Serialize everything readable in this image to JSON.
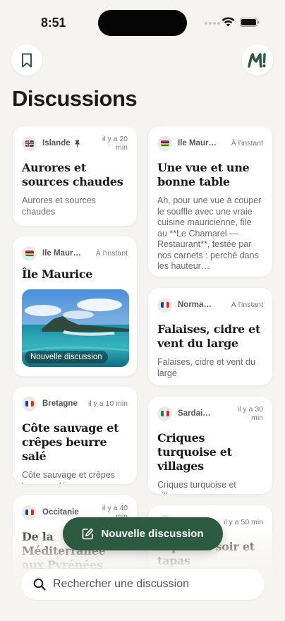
{
  "status_bar": {
    "time": "8:51"
  },
  "header": {
    "title": "Discussions"
  },
  "cards": [
    {
      "region": "Islande",
      "time": "il y a 20 min",
      "title": "Aurores et sources chaudes",
      "body": "Aurores et sources chaudes"
    },
    {
      "region": "Île Maurice",
      "time": "À l'instant",
      "title": "Une vue et une bonne table",
      "body": "Ah, pour une vue à couper le souffle avec une vraie cuisine mauricienne, file au **Le Chamarel — Restaurant**, testée par nos carnets : perché dans les hauteur…"
    },
    {
      "region": "Île Maurice",
      "time": "À l'instant",
      "title": "Île Maurice",
      "photo_label": "Nouvelle discussion"
    },
    {
      "region": "Normandie",
      "time": "À l'instant",
      "title": "Falaises, cidre et vent du large",
      "body": "Falaises, cidre et vent du large"
    },
    {
      "region": "Bretagne",
      "time": "il y a 10 min",
      "title": "Côte sauvage et crêpes beurre salé",
      "body": "Côte sauvage et crêpes beurre salé"
    },
    {
      "region": "Sardaigne",
      "time": "il y a 30 min",
      "title": "Criques turquoise et villages",
      "body": "Criques turquoise et villages"
    },
    {
      "region": "Occitanie",
      "time": "il y a 40 min",
      "title": "De la Méditerranée aux Pyrénées"
    },
    {
      "time": "il y a 50 min",
      "title": "Tapas du soir et tapas"
    }
  ],
  "fab": {
    "label": "Nouvelle discussion"
  },
  "search": {
    "placeholder": "Rechercher une discussion"
  },
  "colors": {
    "accent": "#2c5a3f",
    "background": "#f5f4f0"
  }
}
